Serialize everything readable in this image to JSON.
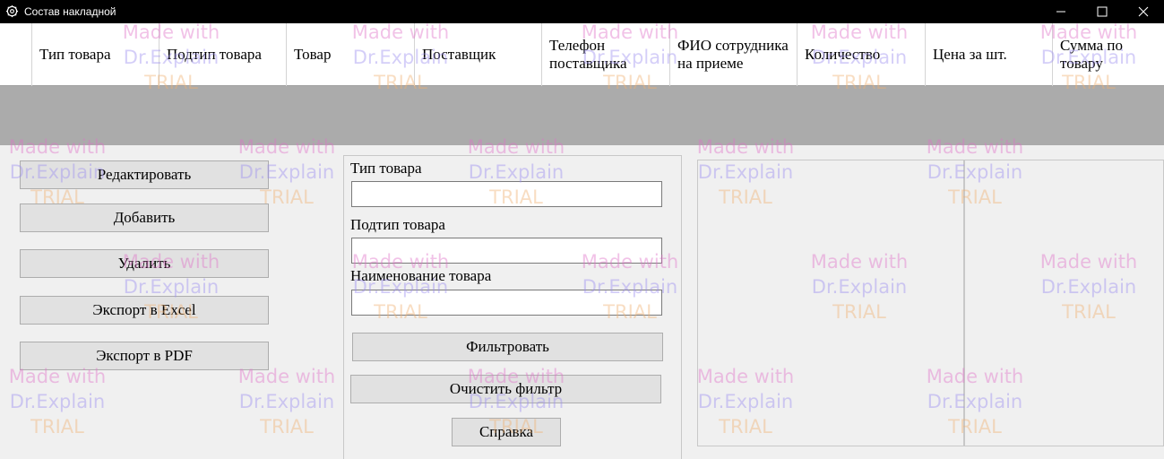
{
  "window": {
    "title": "Состав накладной",
    "icon": "app-gear-icon",
    "controls": [
      "minimize-icon",
      "maximize-icon",
      "close-icon"
    ]
  },
  "grid": {
    "columns": [
      "Тип товара",
      "Подтип товара",
      "Товар",
      "Поставщик",
      "Телефон поставщика",
      "ФИО сотрудника на приеме",
      "Количество",
      "Цена за шт.",
      "Сумма по товару"
    ],
    "new_row_marker": "▸*"
  },
  "actions": {
    "edit": "Редактировать",
    "add": "Добавить",
    "delete": "Удалить",
    "export_excel": "Экспорт в Excel",
    "export_pdf": "Экспорт в PDF"
  },
  "filter": {
    "type_label": "Тип товара",
    "type_value": "",
    "subtype_label": "Подтип товара",
    "subtype_value": "",
    "name_label": "Наименование товара",
    "name_value": "",
    "apply_button": "Фильтровать",
    "clear_button": "Очистить фильтр",
    "help_button": "Справка"
  },
  "watermark": {
    "line1": "Made with",
    "line2": "Dr.Explain",
    "line3": "TRIAL"
  },
  "colors": {
    "selection": "#0078d7",
    "empty_grid_area": "#ababab",
    "titlebar": "#000000"
  }
}
